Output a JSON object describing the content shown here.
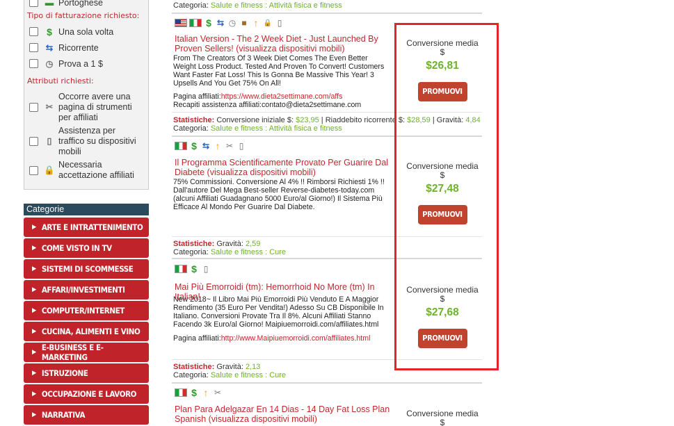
{
  "filters": {
    "language_partial": "Portoghese",
    "billing_title": "Tipo di fatturazione richiesto:",
    "billing_options": [
      {
        "icon": "dollar-icon",
        "label": "Una sola volta"
      },
      {
        "icon": "recurring-icon",
        "label": "Ricorrente"
      },
      {
        "icon": "clock-icon",
        "label": "Prova a 1 $"
      }
    ],
    "attributes_title": "Attributi richiesti:",
    "attribute_options": [
      {
        "icon": "tools-icon",
        "label": "Occorre avere una pagina di strumenti per affiliati"
      },
      {
        "icon": "mobile-icon",
        "label": "Assistenza per traffico su dispositivi mobili"
      },
      {
        "icon": "lock-icon",
        "label": "Necessaria accettazione affiliati"
      }
    ]
  },
  "categories": {
    "header": "Categorie",
    "items": [
      "ARTE E INTRATTENIMENTO",
      "COME VISTO IN TV",
      "SISTEMI DI SCOMMESSE",
      "AFFARI/INVESTIMENTI",
      "COMPUTER/INTERNET",
      "CUCINA, ALIMENTI E VINO",
      "E-BUSINESS E E-MARKETING",
      "ISTRUZIONE",
      "OCCUPAZIONE E LAVORO",
      "NARRATIVA"
    ]
  },
  "top_category": {
    "label": "Categoria:",
    "value": "Salute e fitness : Attività fisica e fitness"
  },
  "products": [
    {
      "title": "Italian Version - The 2 Week Diet - Just Launched By Proven Sellers! (visualizza dispositivi mobili)",
      "description": "From The Creators Of 3 Week Diet Comes The Even Better Weight Loss Product. Tested And Proven To Convert! Customers Want Faster Fat Loss! This Is Gonna Be Massive This Year! 3 Upsells And You Get 75% On All!",
      "affiliate_page_label": "Pagina affiliati:",
      "affiliate_page_url": "https://www.dieta2settimane.com/affs",
      "contact_label": "Recapiti assistenza affiliati:",
      "contact_value": "contato@dieta2settimane.com",
      "stats_label": "Statistiche:",
      "stats_initial_label": "Conversione iniziale $:",
      "stats_initial_value": "$23,95",
      "stats_rebill_label": "Riaddebito ricorrente $:",
      "stats_rebill_value": "$28,59",
      "stats_gravity_label": "Gravità:",
      "stats_gravity_value": "4,84",
      "category_label": "Categoria:",
      "category_value": "Salute e fitness : Attività fisica e fitness",
      "conv_label": "Conversione media",
      "conv_currency": "$",
      "conv_value": "$26,81",
      "promo_label": "PROMUOVI"
    },
    {
      "title": "Il Programma Scientificamente Provato Per Guarire Dal Diabete (visualizza dispositivi mobili)",
      "description": "75% Commissioni. Conversione Al 4% !! Rimborsi Richiesti 1% !! Dall'autore Del Mega Best-seller Reverse-diabetes-today.com (alcuni Affiliati Guadagnano 5000 Euro/al Giorno!) Il Sistema Più Efficace Al Mondo Per Guarire Dal Diabete.",
      "stats_label": "Statistiche:",
      "stats_gravity_label": "Gravità:",
      "stats_gravity_value": "2,59",
      "category_label": "Categoria:",
      "category_value": "Salute e fitness : Cure",
      "conv_label": "Conversione media",
      "conv_currency": "$",
      "conv_value": "$27,48",
      "promo_label": "PROMUOVI"
    },
    {
      "title": "Mai Più Emorroidi (tm): Hemorrhoid No More (tm) In Italian!",
      "description": "New 2018~ Il Libro Mai Più Emorroidi Più Venduto E A Maggior Rendimento (35 Euro Per Vendita!) Adesso Su CB Disponibile In Italiano. Conversioni Provate Tra Il 8%. Alcuni Affiliati Stanno Facendo 3k Euro/al Giorno! Maipiuemorroidi.com/affiliates.html",
      "affiliate_page_label": "Pagina affiliati:",
      "affiliate_page_url": "http://www.Maipiuemorroidi.com/affiliates.html",
      "stats_label": "Statistiche:",
      "stats_gravity_label": "Gravità:",
      "stats_gravity_value": "2,13",
      "category_label": "Categoria:",
      "category_value": "Salute e fitness : Cure",
      "conv_label": "Conversione media",
      "conv_currency": "$",
      "conv_value": "$27,68",
      "promo_label": "PROMUOVI"
    },
    {
      "title": "Plan Para Adelgazar En 14 Dias - 14 Day Fat Loss Plan Spanish (visualizza dispositivi mobili)",
      "conv_label": "Conversione media",
      "conv_currency": "$"
    }
  ],
  "colors": {
    "accent_red": "#c0272d",
    "green": "#6fb12c",
    "category_bg": "#c0232a",
    "highlight": "#e3242b"
  }
}
